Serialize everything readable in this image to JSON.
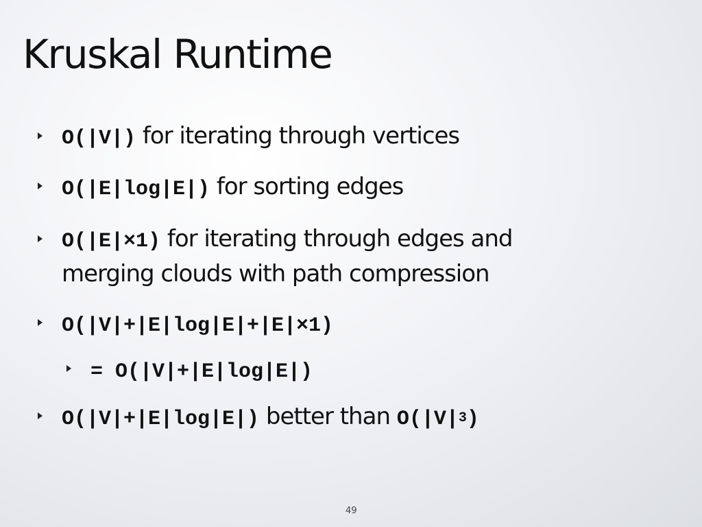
{
  "slide": {
    "title": "Kruskal Runtime",
    "page_number": "49"
  },
  "bullets": [
    {
      "code": "O(|V|)",
      "text": "for iterating through vertices"
    },
    {
      "code": "O(|E|log|E|)",
      "text": "for sorting edges"
    },
    {
      "code": "O(|E|×1)",
      "text": "for iterating through edges and",
      "text_cont": "merging clouds with path compression"
    },
    {
      "code": "O(|V|+|E|log|E|+|E|×1)"
    },
    {
      "code": "= O(|V|+|E|log|E|)"
    },
    {
      "code": "O(|V|+|E|log|E|)",
      "text": "better than",
      "code2": "O(|V|",
      "sup": "3",
      "code2_end": ")"
    }
  ]
}
